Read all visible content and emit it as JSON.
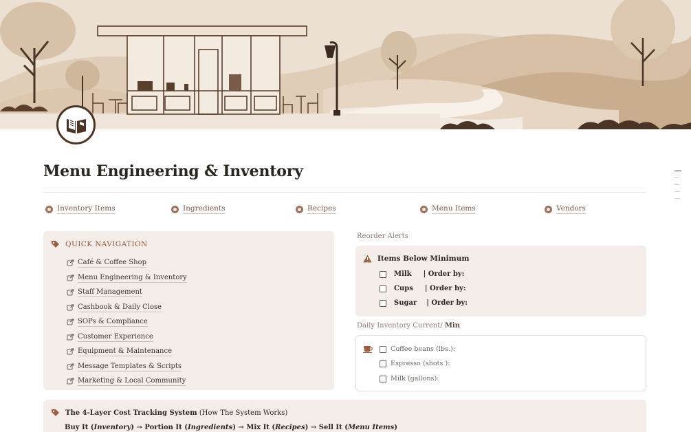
{
  "page": {
    "title": "Menu Engineering & Inventory",
    "icon": "open-book-icon"
  },
  "links": [
    {
      "label": "Inventory Items",
      "icon": "circle-link-icon"
    },
    {
      "label": "Ingredients",
      "icon": "circle-link-icon"
    },
    {
      "label": "Recipes",
      "icon": "circle-link-icon"
    },
    {
      "label": "Menu Items",
      "icon": "circle-link-icon"
    },
    {
      "label": "Vendors",
      "icon": "circle-link-icon"
    }
  ],
  "quick_nav": {
    "heading": "QUICK NAVIGATION",
    "icon": "tag-icon",
    "items": [
      {
        "label": "Café & Coffee Shop"
      },
      {
        "label": "Menu Engineering & Inventory"
      },
      {
        "label": "Staff Management"
      },
      {
        "label": "Cashbook & Daily Close"
      },
      {
        "label": "SOPs & Compliance"
      },
      {
        "label": "Customer Experience"
      },
      {
        "label": "Equipment & Maintenance"
      },
      {
        "label": "Message Templates & Scripts"
      },
      {
        "label": "Marketing & Local Community"
      }
    ]
  },
  "reorder": {
    "section_label": "Reorder Alerts",
    "heading": "Items Below Minimum",
    "icon": "warning-icon",
    "items": [
      {
        "name": "Milk",
        "suffix": "| Order by:",
        "checked": false
      },
      {
        "name": "Cups",
        "suffix": "| Order by:",
        "checked": false
      },
      {
        "name": "Sugar",
        "suffix": "| Order by:",
        "checked": false
      }
    ]
  },
  "daily": {
    "section_label": "Daily Inventory Current/",
    "section_label_bold": "Min",
    "icon": "coffee-cup-icon",
    "items": [
      {
        "label": "Coffee beans (lbs.):",
        "checked": false
      },
      {
        "label": "Espresso (shots ):",
        "checked": false
      },
      {
        "label": "Milk (gallons):",
        "checked": false
      }
    ]
  },
  "cost_system": {
    "heading_bold": "The 4-Layer Cost Tracking System",
    "heading_rest": "(How The System Works)",
    "icon": "tag-icon",
    "flow": {
      "s1": "Buy It (",
      "s1i": "Inventory",
      "s1e": ")",
      "arrow": "→",
      "s2": "Portion It (",
      "s2i": "Ingredients",
      "s2e": ")",
      "s3": "Mix It (",
      "s3i": "Recipes",
      "s3e": ")",
      "s4": "Sell It (",
      "s4i": "Menu Items",
      "s4e": ")"
    }
  },
  "colors": {
    "accent": "#8f5a3e",
    "callout_bg": "#f4ede9",
    "dark_brown": "#4a3426"
  }
}
